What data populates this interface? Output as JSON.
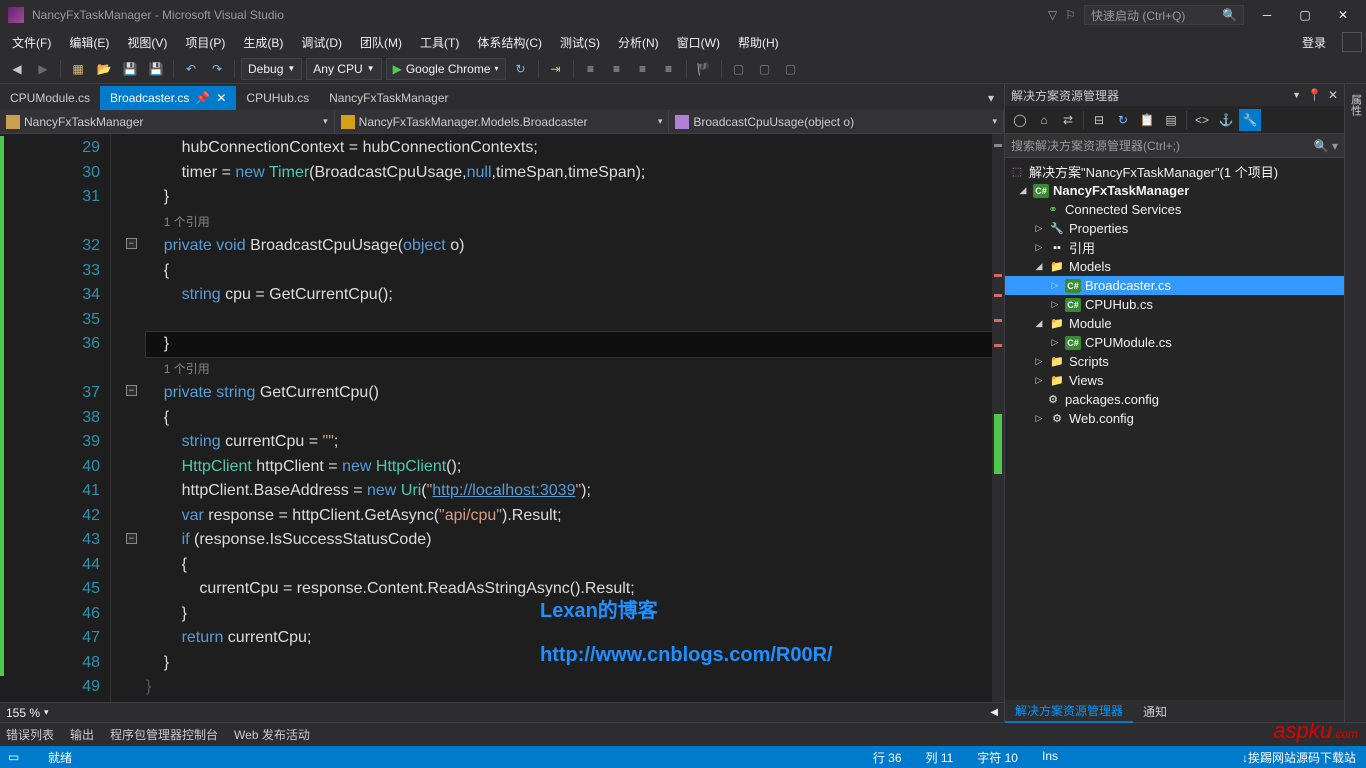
{
  "title": "NancyFxTaskManager - Microsoft Visual Studio",
  "quick_launch": "快速启动 (Ctrl+Q)",
  "menu": [
    "文件(F)",
    "编辑(E)",
    "视图(V)",
    "项目(P)",
    "生成(B)",
    "调试(D)",
    "团队(M)",
    "工具(T)",
    "体系结构(C)",
    "测试(S)",
    "分析(N)",
    "窗口(W)",
    "帮助(H)"
  ],
  "login": "登录",
  "toolbar": {
    "config": "Debug",
    "platform": "Any CPU",
    "run": "Google Chrome"
  },
  "tabs": [
    {
      "label": "CPUModule.cs",
      "active": false
    },
    {
      "label": "Broadcaster.cs",
      "active": true
    },
    {
      "label": "CPUHub.cs",
      "active": false
    },
    {
      "label": "NancyFxTaskManager",
      "active": false
    }
  ],
  "nav": {
    "project": "NancyFxTaskManager",
    "class": "NancyFxTaskManager.Models.Broadcaster",
    "member": "BroadcastCpuUsage(object o)"
  },
  "code_lines": [
    {
      "n": "29",
      "html": "        hubConnectionContext = hubConnectionContexts;"
    },
    {
      "n": "30",
      "html": "        timer = <span class='kw'>new</span> <span class='type'>Timer</span>(BroadcastCpuUsage,<span class='kw'>null</span>,timeSpan,timeSpan);"
    },
    {
      "n": "31",
      "html": "    }"
    },
    {
      "n": "",
      "html": "    <span class='codelens'>1 个引用</span>"
    },
    {
      "n": "32",
      "html": "    <span class='kw'>private</span> <span class='kw'>void</span> BroadcastCpuUsage(<span class='kw'>object</span> o)"
    },
    {
      "n": "33",
      "html": "    {"
    },
    {
      "n": "34",
      "html": "        <span class='kw'>string</span> cpu = GetCurrentCpu();"
    },
    {
      "n": "35",
      "html": ""
    },
    {
      "n": "36",
      "html": "    }",
      "current": true
    },
    {
      "n": "",
      "html": "    <span class='codelens'>1 个引用</span>"
    },
    {
      "n": "37",
      "html": "    <span class='kw'>private</span> <span class='kw'>string</span> GetCurrentCpu()"
    },
    {
      "n": "38",
      "html": "    {"
    },
    {
      "n": "39",
      "html": "        <span class='kw'>string</span> currentCpu = <span class='str'>\"\"</span>;"
    },
    {
      "n": "40",
      "html": "        <span class='type'>HttpClient</span> httpClient = <span class='kw'>new</span> <span class='type'>HttpClient</span>();"
    },
    {
      "n": "41",
      "html": "        httpClient.BaseAddress = <span class='kw'>new</span> <span class='type'>Uri</span>(<span class='str'>\"</span><span class='url'>http://localhost:3039</span><span class='str'>\"</span>);"
    },
    {
      "n": "42",
      "html": "        <span class='kw'>var</span> response = httpClient.GetAsync(<span class='str'>\"api/cpu\"</span>).Result;"
    },
    {
      "n": "43",
      "html": "        <span class='kw'>if</span> (response.IsSuccessStatusCode)"
    },
    {
      "n": "44",
      "html": "        {"
    },
    {
      "n": "45",
      "html": "            currentCpu = response.Content.ReadAsStringAsync().Result;"
    },
    {
      "n": "46",
      "html": "        }"
    },
    {
      "n": "47",
      "html": "        <span class='kw'>return</span> currentCpu;"
    },
    {
      "n": "48",
      "html": "    }"
    },
    {
      "n": "49",
      "html": "}",
      "faded": true
    }
  ],
  "zoom": "155 %",
  "solution_explorer": {
    "title": "解决方案资源管理器",
    "search": "搜索解决方案资源管理器(Ctrl+;)",
    "solution": "解决方案\"NancyFxTaskManager\"(1 个项目)",
    "project": "NancyFxTaskManager",
    "nodes": {
      "connected": "Connected Services",
      "properties": "Properties",
      "references": "引用",
      "models": "Models",
      "broadcaster": "Broadcaster.cs",
      "cpuhub": "CPUHub.cs",
      "module": "Module",
      "cpumodule": "CPUModule.cs",
      "scripts": "Scripts",
      "views": "Views",
      "packages": "packages.config",
      "webconfig": "Web.config"
    },
    "tabs": [
      "解决方案资源管理器",
      "通知"
    ]
  },
  "vert_tab": "属性",
  "bottom_tabs": [
    "错误列表",
    "输出",
    "程序包管理器控制台",
    "Web 发布活动"
  ],
  "status": {
    "ready": "就绪",
    "line": "行 36",
    "col": "列 11",
    "char": "字符 10",
    "ins": "Ins",
    "right": "↓挨踢网站源码下载站"
  },
  "overlay1": "Lexan的博客",
  "overlay2": "http://www.cnblogs.com/R00R/",
  "watermark": "aspku",
  "watermark_com": ".com"
}
